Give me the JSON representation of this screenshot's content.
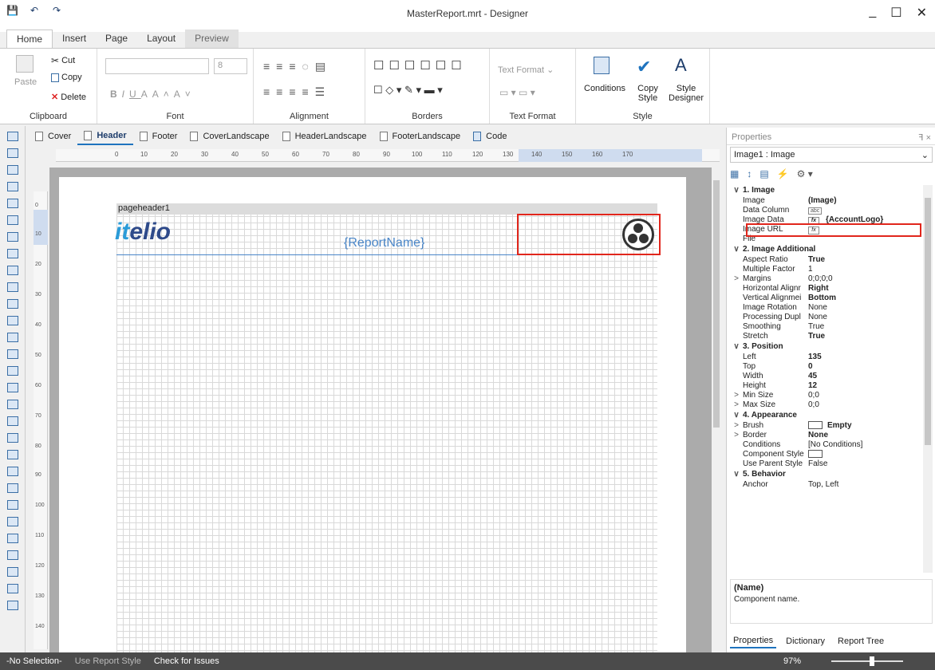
{
  "window": {
    "title": "MasterReport.mrt - Designer",
    "minimize": "_",
    "maximize": "☐",
    "close": "✕"
  },
  "qat": {
    "save": "💾",
    "undo": "↶",
    "redo": "↷"
  },
  "menu_tabs": [
    "Home",
    "Insert",
    "Page",
    "Layout",
    "Preview"
  ],
  "ribbon": {
    "clipboard": {
      "label": "Clipboard",
      "paste": "Paste",
      "cut": "Cut",
      "copy": "Copy",
      "delete": "Delete"
    },
    "font": {
      "label": "Font",
      "size": "8",
      "bold": "B",
      "italic": "I",
      "underline": "U",
      "color": "A",
      "grow": "A˄",
      "shrink": "A˅"
    },
    "alignment": {
      "label": "Alignment"
    },
    "borders": {
      "label": "Borders"
    },
    "text_format": {
      "label": "Text Format",
      "dropdown": "Text Format"
    },
    "style": {
      "label": "Style",
      "conditions": "Conditions",
      "copy_style": "Copy Style",
      "style_designer": "Style Designer"
    }
  },
  "page_tabs": [
    {
      "label": "Cover",
      "active": false
    },
    {
      "label": "Header",
      "active": true
    },
    {
      "label": "Footer",
      "active": false
    },
    {
      "label": "CoverLandscape",
      "active": false
    },
    {
      "label": "HeaderLandscape",
      "active": false
    },
    {
      "label": "FooterLandscape",
      "active": false
    },
    {
      "label": "Code",
      "active": false
    }
  ],
  "hruler_ticks": [
    "0",
    "10",
    "20",
    "30",
    "40",
    "50",
    "60",
    "70",
    "80",
    "90",
    "100",
    "110",
    "120",
    "130",
    "140",
    "150",
    "160",
    "170"
  ],
  "vruler_ticks": [
    "0",
    "10",
    "20",
    "30",
    "40",
    "50",
    "60",
    "70",
    "80",
    "90",
    "100",
    "110",
    "120",
    "130",
    "140"
  ],
  "canvas": {
    "band_title": "pageheader1",
    "logo_it": "it",
    "logo_rest": "elio",
    "report_name": "{ReportName}"
  },
  "properties": {
    "header": "Properties",
    "pin": "ꟻ",
    "close": "×",
    "selected": "Image1 : Image",
    "rows": [
      {
        "type": "cat",
        "expander": "∨",
        "name": "1. Image"
      },
      {
        "expander": "",
        "name": "Image",
        "value": "(Image)",
        "bold": true
      },
      {
        "expander": "",
        "name": "Data Column",
        "value": "abc",
        "icon": true
      },
      {
        "expander": "",
        "name": "Image Data",
        "value": "{AccountLogo}",
        "bold": true,
        "fx": true
      },
      {
        "expander": "",
        "name": "Image URL",
        "value": "",
        "fx": true
      },
      {
        "expander": "",
        "name": "File",
        "value": ""
      },
      {
        "type": "cat",
        "expander": "∨",
        "name": "2. Image  Additional"
      },
      {
        "expander": "",
        "name": "Aspect Ratio",
        "value": "True",
        "bold": true
      },
      {
        "expander": "",
        "name": "Multiple Factor",
        "value": "1"
      },
      {
        "expander": ">",
        "name": "Margins",
        "value": "0;0;0;0"
      },
      {
        "expander": "",
        "name": "Horizontal Alignr",
        "value": "Right",
        "bold": true
      },
      {
        "expander": "",
        "name": "Vertical Alignmei",
        "value": "Bottom",
        "bold": true
      },
      {
        "expander": "",
        "name": "Image Rotation",
        "value": "None"
      },
      {
        "expander": "",
        "name": "Processing Dupl",
        "value": "None"
      },
      {
        "expander": "",
        "name": "Smoothing",
        "value": "True"
      },
      {
        "expander": "",
        "name": "Stretch",
        "value": "True",
        "bold": true
      },
      {
        "type": "cat",
        "expander": "∨",
        "name": "3. Position"
      },
      {
        "expander": "",
        "name": "Left",
        "value": "135",
        "bold": true
      },
      {
        "expander": "",
        "name": "Top",
        "value": "0",
        "bold": true
      },
      {
        "expander": "",
        "name": "Width",
        "value": "45",
        "bold": true
      },
      {
        "expander": "",
        "name": "Height",
        "value": "12",
        "bold": true
      },
      {
        "expander": ">",
        "name": "Min Size",
        "value": "0;0"
      },
      {
        "expander": ">",
        "name": "Max Size",
        "value": "0;0"
      },
      {
        "type": "cat",
        "expander": "∨",
        "name": "4. Appearance"
      },
      {
        "expander": ">",
        "name": "Brush",
        "value": "Empty",
        "bold": true,
        "swatch": true
      },
      {
        "expander": ">",
        "name": "Border",
        "value": "None",
        "bold": true
      },
      {
        "expander": "",
        "name": "Conditions",
        "value": "[No Conditions]"
      },
      {
        "expander": "",
        "name": "Component Style",
        "value": "",
        "swatch": true
      },
      {
        "expander": "",
        "name": "Use Parent Style",
        "value": "False"
      },
      {
        "type": "cat",
        "expander": "∨",
        "name": "5. Behavior"
      },
      {
        "expander": "",
        "name": "Anchor",
        "value": "Top, Left"
      }
    ],
    "desc_title": "(Name)",
    "desc_text": "Component name.",
    "bottom_tabs": [
      "Properties",
      "Dictionary",
      "Report Tree"
    ]
  },
  "status": {
    "selection": "-No Selection-",
    "use_report_style": "Use Report Style",
    "check": "Check for Issues",
    "zoom": "97%"
  },
  "colors": {
    "accent": "#1e73be",
    "highlight": "#e1261c",
    "status_bg": "#4b4b4b"
  }
}
